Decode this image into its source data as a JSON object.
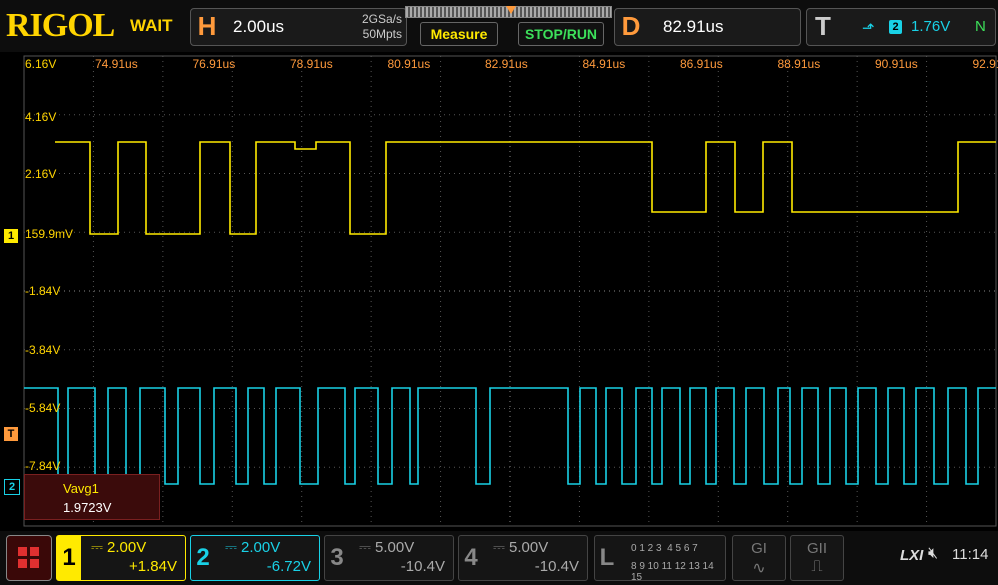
{
  "brand": "RIGOL",
  "status": "WAIT",
  "horizontal": {
    "letter": "H",
    "timebase": "2.00us",
    "sample_rate": "2GSa/s",
    "memory": "50Mpts"
  },
  "buttons": {
    "measure": "Measure",
    "stop_run": "STOP/RUN"
  },
  "delay": {
    "letter": "D",
    "value": "82.91us"
  },
  "trigger": {
    "letter": "T",
    "channel": "2",
    "level": "1.76V",
    "mode": "N"
  },
  "x_ticks": [
    "74.91us",
    "76.91us",
    "78.91us",
    "80.91us",
    "82.91us",
    "84.91us",
    "86.91us",
    "88.91us",
    "90.91us",
    "92.91us"
  ],
  "y_labels": [
    "6.16V",
    "4.16V",
    "2.16V",
    "159.9mV",
    "-1.84V",
    "-3.84V",
    "-5.84V",
    "-7.84V"
  ],
  "markers": {
    "ch1": "1",
    "trig": "T",
    "ch2": "2"
  },
  "measurement": {
    "name": "Vavg1",
    "value": "1.9723V"
  },
  "channels": [
    {
      "num": "1",
      "scale": "2.00V",
      "offset": "+1.84V",
      "color": "#ffea00"
    },
    {
      "num": "2",
      "scale": "2.00V",
      "offset": "-6.72V",
      "color": "#19d1e6"
    },
    {
      "num": "3",
      "scale": "5.00V",
      "offset": "-10.4V",
      "color": "#888888"
    },
    {
      "num": "4",
      "scale": "5.00V",
      "offset": "-10.4V",
      "color": "#888888"
    }
  ],
  "logic": {
    "letter": "L",
    "row1": "0 1 2 3  4 5 6 7",
    "row2": "8 9 10 11 12 13 14 15"
  },
  "gen1": "GI",
  "gen2": "GII",
  "lxi": "LXI",
  "time": "11:14",
  "colors": {
    "ch1": "#ffea00",
    "ch2": "#19d1e6",
    "accent": "#ff9a3c",
    "grid": "#666666"
  }
}
